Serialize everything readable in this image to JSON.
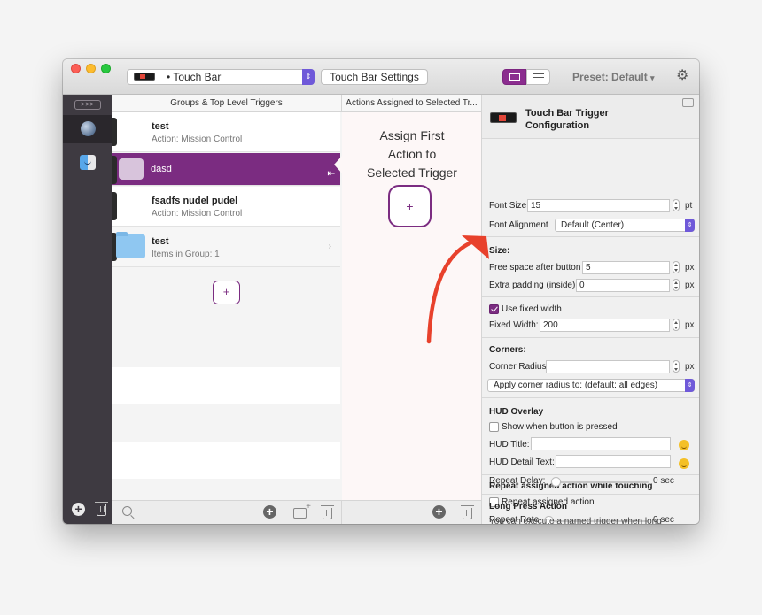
{
  "titlebar": {
    "trigger_selector": "• Touch Bar",
    "settings_button": "Touch Bar Settings",
    "preset_label": "Preset: Default",
    "preset_chevron": "▾"
  },
  "sidebar": {
    "collapse_label": ">>>"
  },
  "columns": {
    "groups_header": "Groups & Top Level Triggers",
    "actions_header": "Actions Assigned to Selected Tr..."
  },
  "triggers": [
    {
      "title": "test",
      "subtitle": "Action: Mission Control"
    },
    {
      "title": "dasd",
      "subtitle": ""
    },
    {
      "title": "fsadfs nudel pudel",
      "subtitle": "Action: Mission Control"
    },
    {
      "title": "test",
      "subtitle": "Items in Group: 1"
    }
  ],
  "actions": {
    "assign_line1": "Assign First",
    "assign_line2": "Action to",
    "assign_line3": "Selected Trigger",
    "add_symbol": "+"
  },
  "config": {
    "title_line1": "Touch Bar Trigger",
    "title_line2": "Configuration",
    "font_size_label": "Font Size",
    "font_size_value": "15",
    "font_size_unit": "pt",
    "font_alignment_label": "Font Alignment",
    "font_alignment_value": "Default (Center)",
    "size_section": "Size:",
    "free_space_label": "Free space after button",
    "free_space_value": "5",
    "extra_padding_label": "Extra padding (inside)",
    "extra_padding_value": "0",
    "px": "px",
    "use_fixed_width_label": "Use fixed width",
    "use_fixed_width_checked": true,
    "fixed_width_label": "Fixed Width:",
    "fixed_width_value": "200",
    "corners_section": "Corners:",
    "corner_radius_label": "Corner Radius",
    "corner_radius_value": "",
    "apply_corner_value": "Apply corner radius to: (default: all edges)",
    "hud_section": "HUD Overlay",
    "show_when_pressed_label": "Show when button is pressed",
    "hud_title_label": "HUD Title:",
    "hud_detail_label": "HUD Detail Text:",
    "repeat_section": "Repeat assigned action while touching",
    "repeat_action_label": "Repeat assigned action",
    "repeat_rate_label": "Repeat Rate:",
    "repeat_rate_value": "0 sec",
    "repeat_delay_label": "Repeat Delay:",
    "repeat_delay_value": "0 sec",
    "long_press_section": "Long Press Action",
    "long_press_text": "You can execute a named trigger when long"
  },
  "colors": {
    "accent_purple": "#7b2c81",
    "annotation_red": "#e8412c"
  }
}
